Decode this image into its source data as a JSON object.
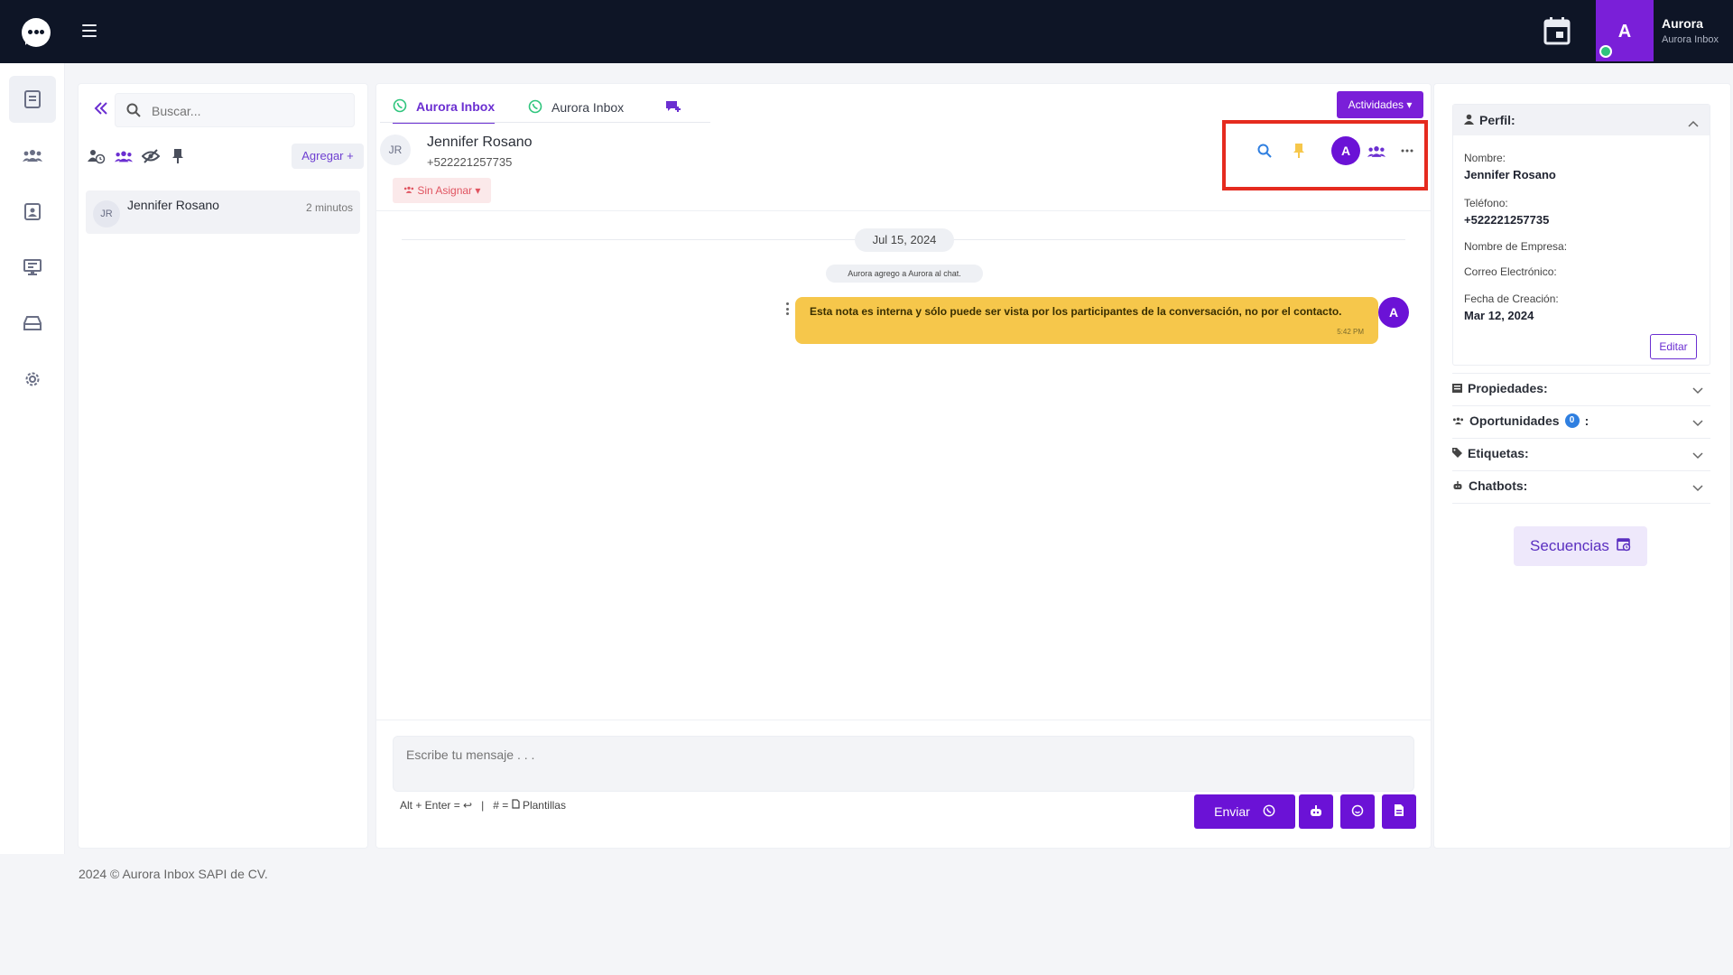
{
  "topbar": {
    "user_initial": "A",
    "user_name": "Aurora",
    "user_org": "Aurora Inbox"
  },
  "nav": {
    "items": [
      "conversations",
      "contacts",
      "contact-card",
      "monitor",
      "inbox",
      "settings"
    ]
  },
  "list": {
    "search_placeholder": "Buscar...",
    "agregar_label": "Agregar +",
    "conversation": {
      "initials": "JR",
      "name": "Jennifer Rosano",
      "time": "2 minutos"
    }
  },
  "chat": {
    "tabs": [
      "Aurora Inbox",
      "Aurora Inbox"
    ],
    "actividades_label": "Actividades ▾",
    "contact": {
      "initials": "JR",
      "name": "Jennifer Rosano",
      "phone": "+522221257735"
    },
    "sin_asignar_label": "Sin Asignar",
    "tool_avatar": "A",
    "date": "Jul 15, 2024",
    "system_message": "Aurora agrego a Aurora al chat.",
    "note": {
      "text": "Esta nota es interna y sólo puede ser vista por los participantes de la conversación, no por el contacto.",
      "time": "5:42 PM",
      "avatar": "A"
    },
    "composer_placeholder": "Escribe tu mensaje . . .",
    "hint_left": "Alt + Enter = ↩",
    "hint_sep": "|",
    "hint_right": "# = ",
    "hint_plantillas": "Plantillas",
    "enviar_label": "Enviar"
  },
  "profile": {
    "title": "Perfil:",
    "nombre_label": "Nombre:",
    "nombre_value": "Jennifer Rosano",
    "telefono_label": "Teléfono:",
    "telefono_value": "+522221257735",
    "empresa_label": "Nombre de Empresa:",
    "correo_label": "Correo Electrónico:",
    "fecha_label": "Fecha de Creación:",
    "fecha_value": "Mar 12, 2024",
    "editar_label": "Editar",
    "propiedades_label": "Propiedades:",
    "oportunidades_label": "Oportunidades",
    "oportunidades_count": "0",
    "oportunidades_colon": ":",
    "etiquetas_label": "Etiquetas:",
    "chatbots_label": "Chatbots:",
    "secuencias_label": "Secuencias"
  },
  "footer": {
    "text": "2024 © Aurora Inbox SAPI de CV."
  },
  "colors": {
    "topbar": "#0e1526",
    "accent": "#6b12d6",
    "note": "#f6c74b",
    "highlight": "#e52b1f"
  }
}
